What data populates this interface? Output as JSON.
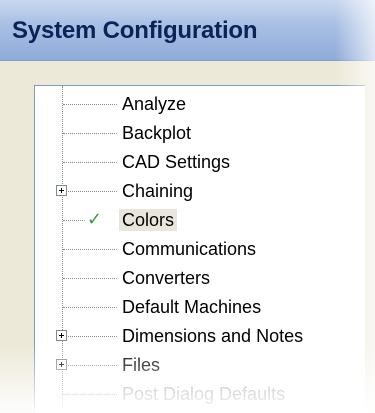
{
  "window": {
    "title": "System Configuration"
  },
  "tree": {
    "items": [
      {
        "label": "Analyze",
        "expandable": false,
        "checked": false
      },
      {
        "label": "Backplot",
        "expandable": false,
        "checked": false
      },
      {
        "label": "CAD Settings",
        "expandable": false,
        "checked": false
      },
      {
        "label": "Chaining",
        "expandable": true,
        "checked": false
      },
      {
        "label": "Colors",
        "expandable": false,
        "checked": true,
        "selected": true
      },
      {
        "label": "Communications",
        "expandable": false,
        "checked": false
      },
      {
        "label": "Converters",
        "expandable": false,
        "checked": false
      },
      {
        "label": "Default Machines",
        "expandable": false,
        "checked": false
      },
      {
        "label": "Dimensions and Notes",
        "expandable": true,
        "checked": false
      },
      {
        "label": "Files",
        "expandable": true,
        "checked": false
      },
      {
        "label": "Post Dialog Defaults",
        "expandable": false,
        "checked": false
      }
    ]
  },
  "icons": {
    "expander": "plus-box-icon",
    "check": "checkmark-icon"
  },
  "colors": {
    "title_text": "#0a2457",
    "check_green": "#2fa02f",
    "selection": "#e8e6dc"
  }
}
